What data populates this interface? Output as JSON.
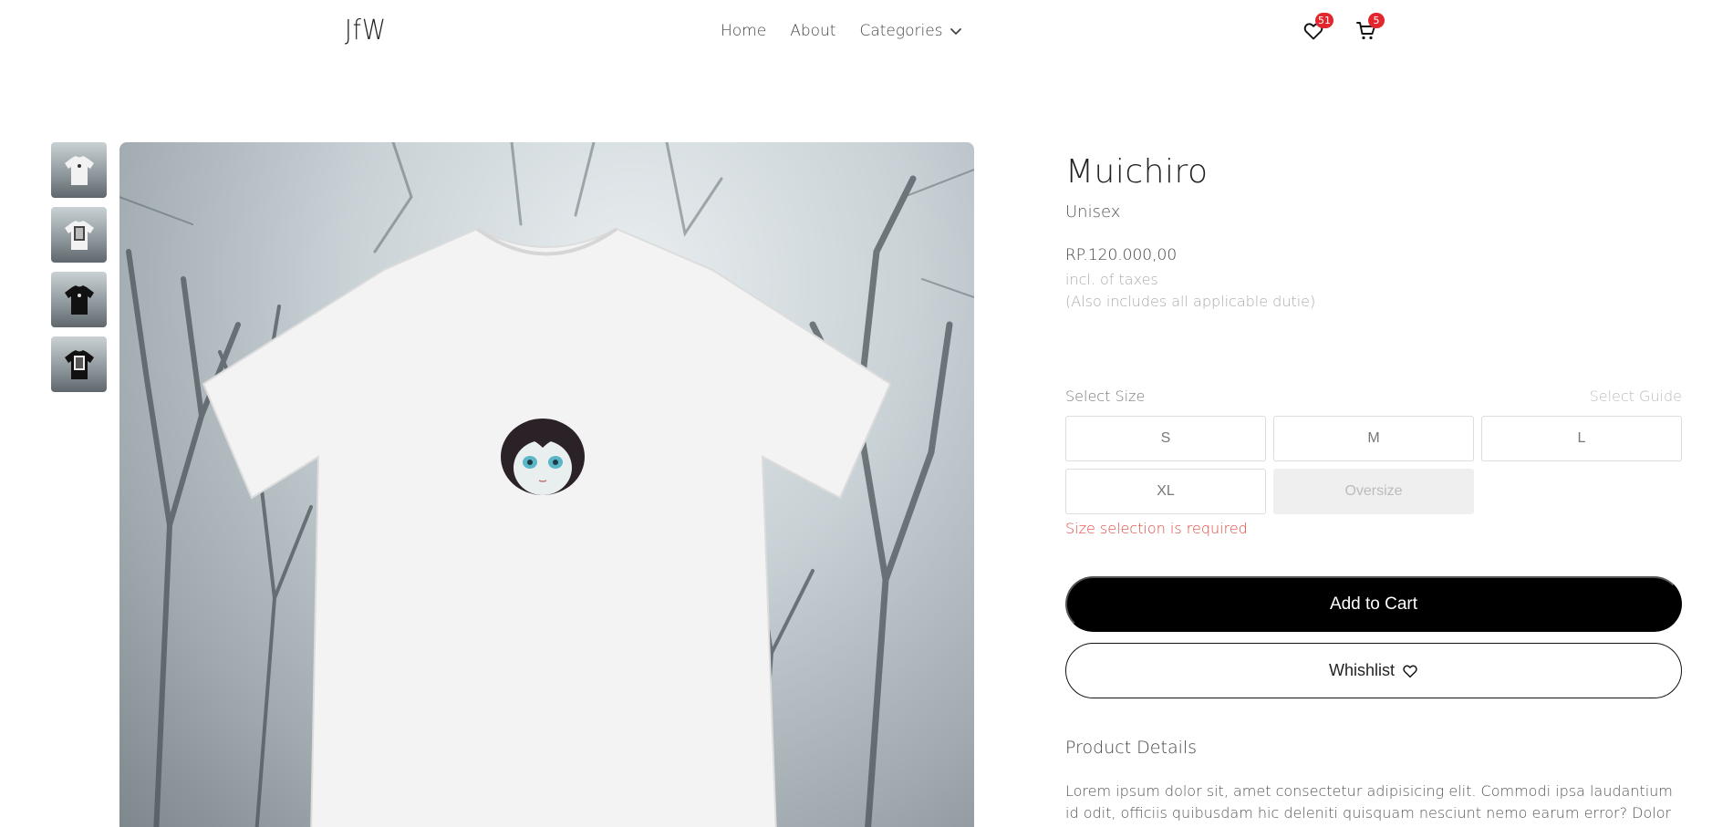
{
  "header": {
    "logo": "JfW",
    "nav": [
      {
        "label": "Home"
      },
      {
        "label": "About"
      },
      {
        "label": "Categories"
      }
    ],
    "wishlist_count": "51",
    "cart_count": "5"
  },
  "gallery": {
    "thumbnails": [
      {
        "icon": "white-tee-thumbnail"
      },
      {
        "icon": "white-tee-print-thumbnail"
      },
      {
        "icon": "black-tee-thumbnail"
      },
      {
        "icon": "black-tee-print-thumbnail"
      }
    ]
  },
  "product": {
    "name": "Muichiro",
    "gender": "Unisex",
    "price": "RP.120.000,00",
    "tax_note": "incl. of taxes",
    "duty_note": "(Also includes all applicable dutie)",
    "size_label": "Select Size",
    "size_guide": "Select Guide",
    "sizes": [
      {
        "label": "S",
        "available": true
      },
      {
        "label": "M",
        "available": true
      },
      {
        "label": "L",
        "available": true
      },
      {
        "label": "XL",
        "available": true
      },
      {
        "label": "Oversize",
        "available": false
      }
    ],
    "size_error": "Size selection is required",
    "add_to_cart": "Add to Cart",
    "wishlist_button": "Whishlist",
    "details_title": "Product Details",
    "details_text": "Lorem ipsum dolor sit, amet consectetur adipisicing elit. Commodi ipsa laudantium id odit, officiis quibusdam hic deleniti quisquam nesciunt nemo earum error? Dolor quia,"
  },
  "colors": {
    "accent": "#000000",
    "badge": "#e3262d",
    "error": "#e0473f"
  }
}
